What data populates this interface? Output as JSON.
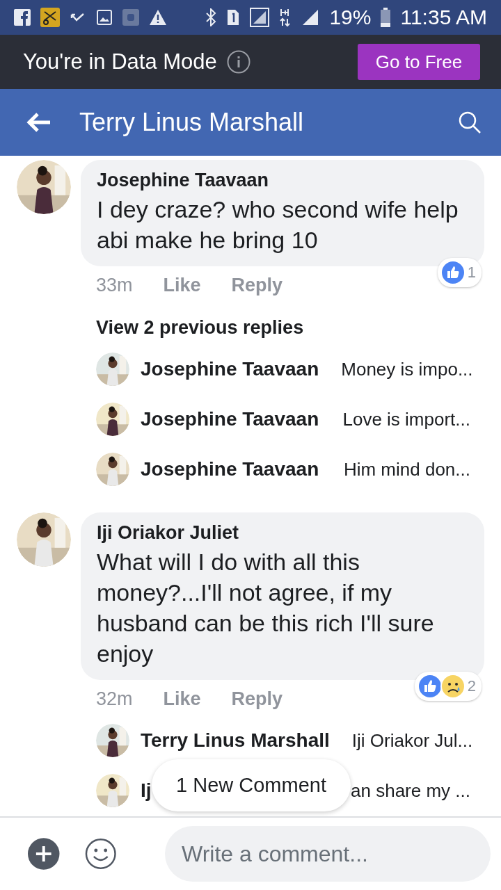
{
  "status_bar": {
    "battery": "19%",
    "time": "11:35 AM"
  },
  "data_banner": {
    "text": "You're in Data Mode",
    "button": "Go to Free"
  },
  "header": {
    "title": "Terry Linus Marshall"
  },
  "comments": [
    {
      "author": "Josephine Taavaan",
      "text": "I dey craze? who second wife help abi make he bring 10",
      "time": "33m",
      "like": "Like",
      "reply": "Reply",
      "reactions": [
        {
          "kind": "like"
        }
      ],
      "reaction_count": "1",
      "previous_replies": "View 2 previous replies",
      "replies": [
        {
          "author": "Josephine Taavaan",
          "text": "Money is impo..."
        },
        {
          "author": "Josephine Taavaan",
          "text": "Love is import..."
        },
        {
          "author": "Josephine Taavaan",
          "text": "Him mind don..."
        }
      ]
    },
    {
      "author": "Iji Oriakor Juliet",
      "text": "What will I do with all this money?...I'll not agree, if my husband can be this rich I'll sure enjoy",
      "time": "32m",
      "like": "Like",
      "reply": "Reply",
      "reactions": [
        {
          "kind": "like"
        },
        {
          "kind": "sad"
        }
      ],
      "reaction_count": "2",
      "replies": [
        {
          "author": "Terry Linus Marshall",
          "text": "Iji Oriakor Jul..."
        },
        {
          "author": "Ij",
          "text": "an share my ..."
        }
      ]
    }
  ],
  "new_comment_pill": "1 New Comment",
  "composer": {
    "placeholder": "Write a comment..."
  }
}
